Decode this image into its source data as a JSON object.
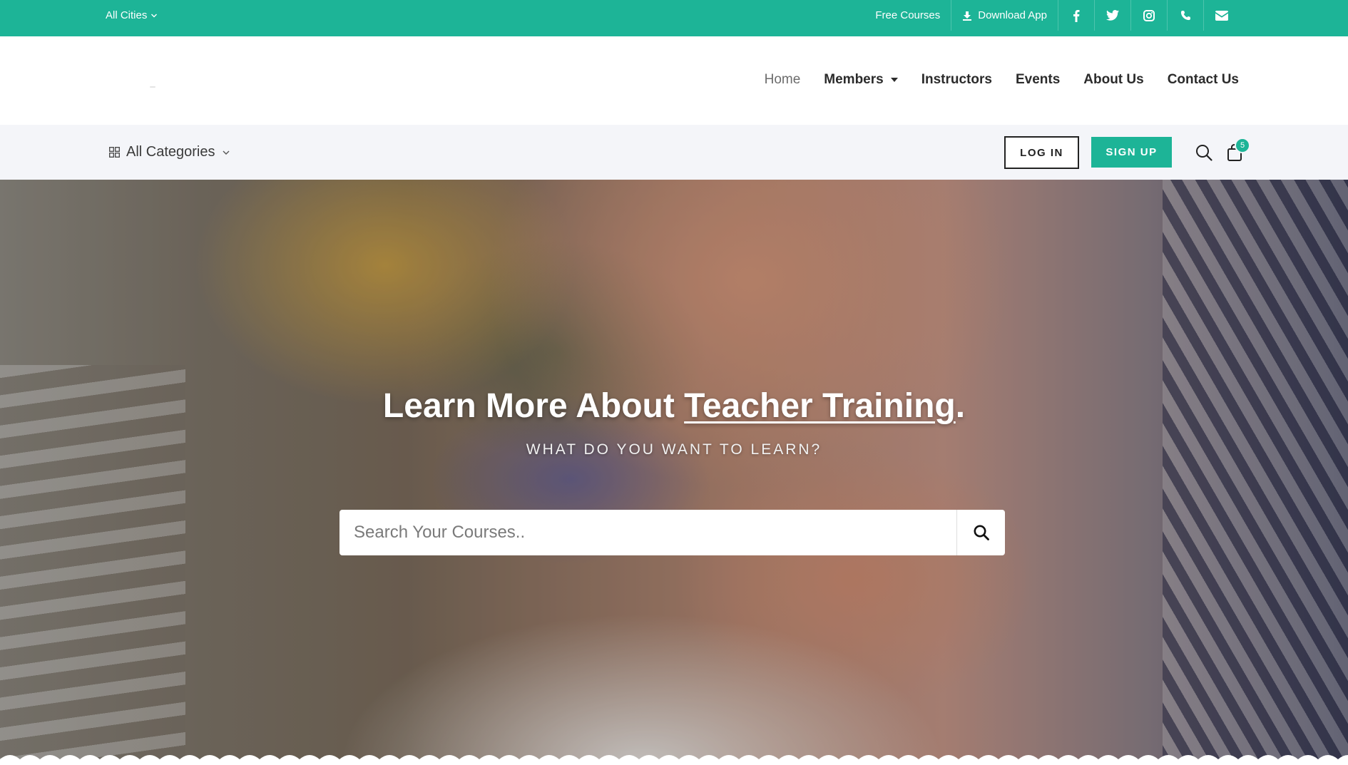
{
  "topbar": {
    "city_label": "All Cities",
    "free_courses": "Free Courses",
    "download_app": "Download App",
    "social_icons": [
      "facebook-icon",
      "twitter-icon",
      "instagram-icon",
      "phone-icon",
      "envelope-icon"
    ]
  },
  "nav": {
    "items": [
      "Home",
      "Members",
      "Instructors",
      "Events",
      "About Us",
      "Contact Us"
    ],
    "active": "Home"
  },
  "catbar": {
    "categories_label": "All Categories",
    "login_label": "LOG IN",
    "signup_label": "SIGN UP",
    "cart_count": "5"
  },
  "hero": {
    "title_prefix": "Learn More About ",
    "title_highlight": "Teacher Training",
    "title_suffix": ".",
    "subtitle": "WHAT DO YOU WANT TO LEARN?",
    "search_placeholder": "Search Your Courses.."
  },
  "colors": {
    "accent": "#1db497",
    "nav_text": "#2b2b2b",
    "catbar_bg": "#f4f5f9"
  }
}
